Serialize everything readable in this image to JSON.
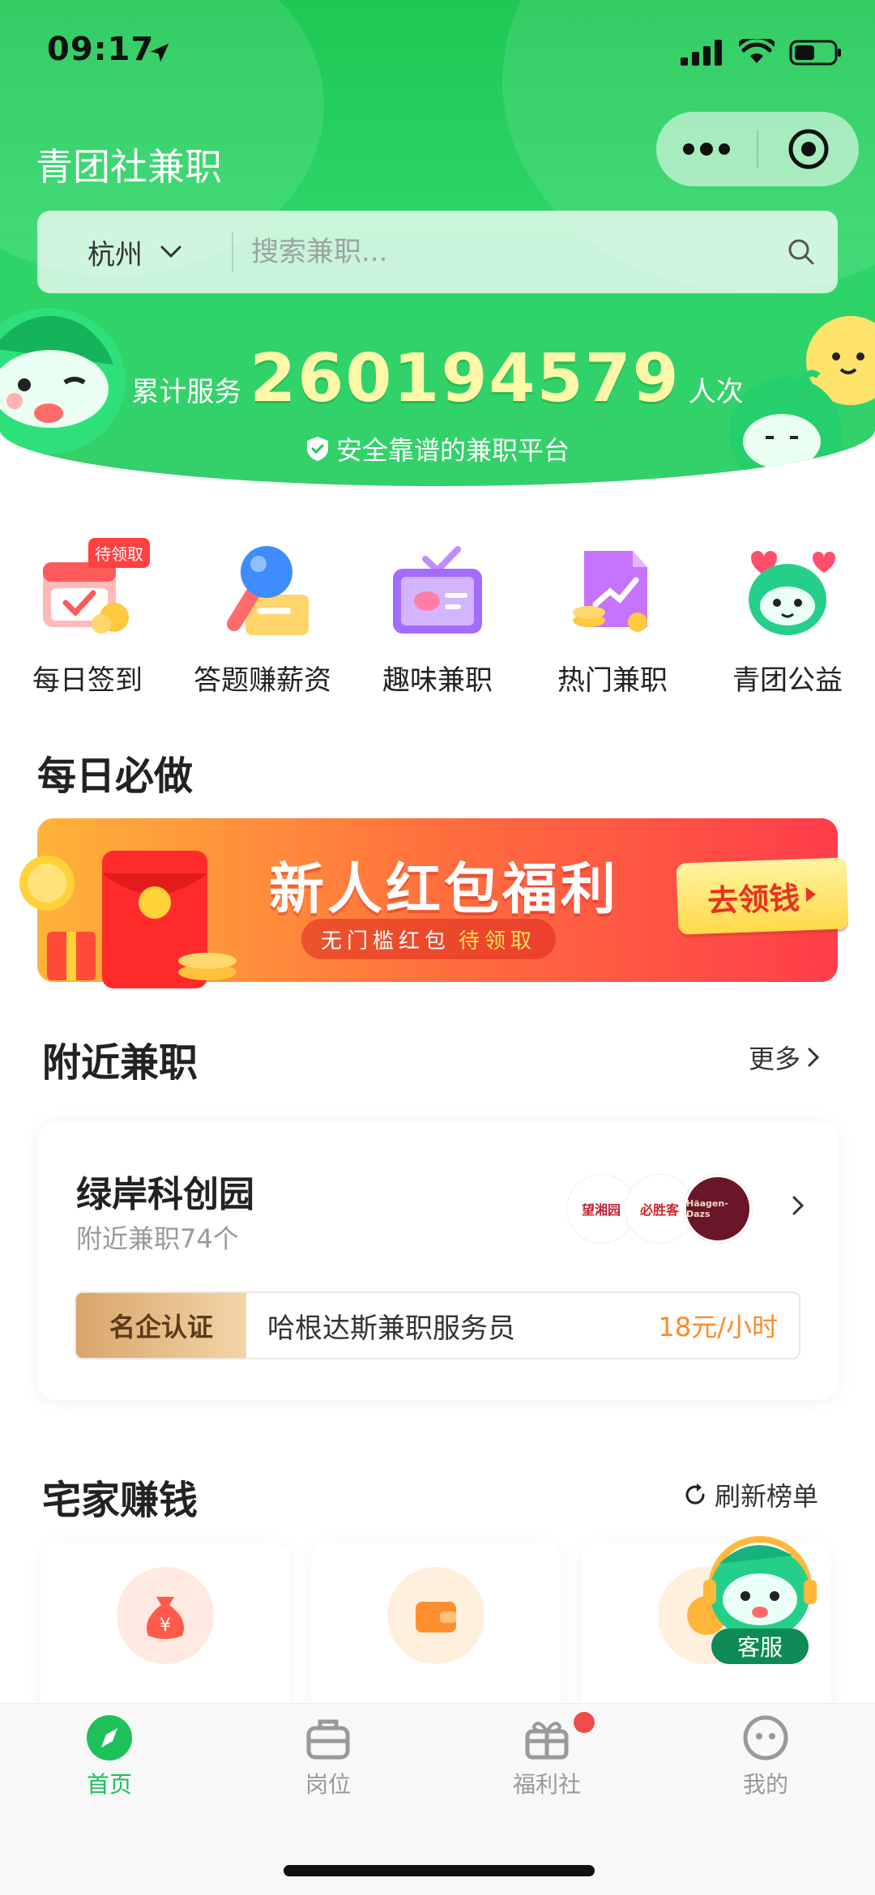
{
  "status_bar": {
    "time": "09:17"
  },
  "header": {
    "title": "青团社兼职",
    "city": "杭州",
    "search_placeholder": "搜索兼职...",
    "stats_prefix": "累计服务",
    "stats_number": "260194579",
    "stats_suffix": "人次",
    "tagline": "安全靠谱的兼职平台"
  },
  "categories": [
    {
      "label": "每日签到",
      "badge": "待领取",
      "icon": "calendar-checkin-icon"
    },
    {
      "label": "答题赚薪资",
      "icon": "microphone-quiz-icon"
    },
    {
      "label": "趣味兼职",
      "icon": "tv-fun-icon"
    },
    {
      "label": "热门兼职",
      "icon": "trending-chart-icon"
    },
    {
      "label": "青团公益",
      "icon": "mascot-charity-icon"
    }
  ],
  "daily": {
    "title": "每日必做",
    "banner_title": "新人红包福利",
    "banner_sub_a": "无门槛红包",
    "banner_sub_b": "待领取",
    "banner_button": "去领钱"
  },
  "nearby": {
    "title": "附近兼职",
    "more": "更多",
    "park_name": "绿岸科创园",
    "park_count": "附近兼职74个",
    "logos": [
      "望湘园",
      "必胜客",
      "Häagen-Dazs"
    ],
    "badge": "名企认证",
    "job_title": "哈根达斯兼职服务员",
    "job_salary": "18元/小时"
  },
  "home": {
    "title": "宅家赚钱",
    "refresh": "刷新榜单",
    "service": "客服"
  },
  "tabbar": {
    "tabs": [
      {
        "label": "首页",
        "active": true
      },
      {
        "label": "岗位",
        "active": false
      },
      {
        "label": "福利社",
        "active": false
      },
      {
        "label": "我的",
        "active": false
      }
    ]
  },
  "colors": {
    "brand_green": "#1ec853",
    "accent_yellow": "#fff8a8",
    "salary_orange": "#ff8a24",
    "tab_active": "#1ec05a"
  }
}
